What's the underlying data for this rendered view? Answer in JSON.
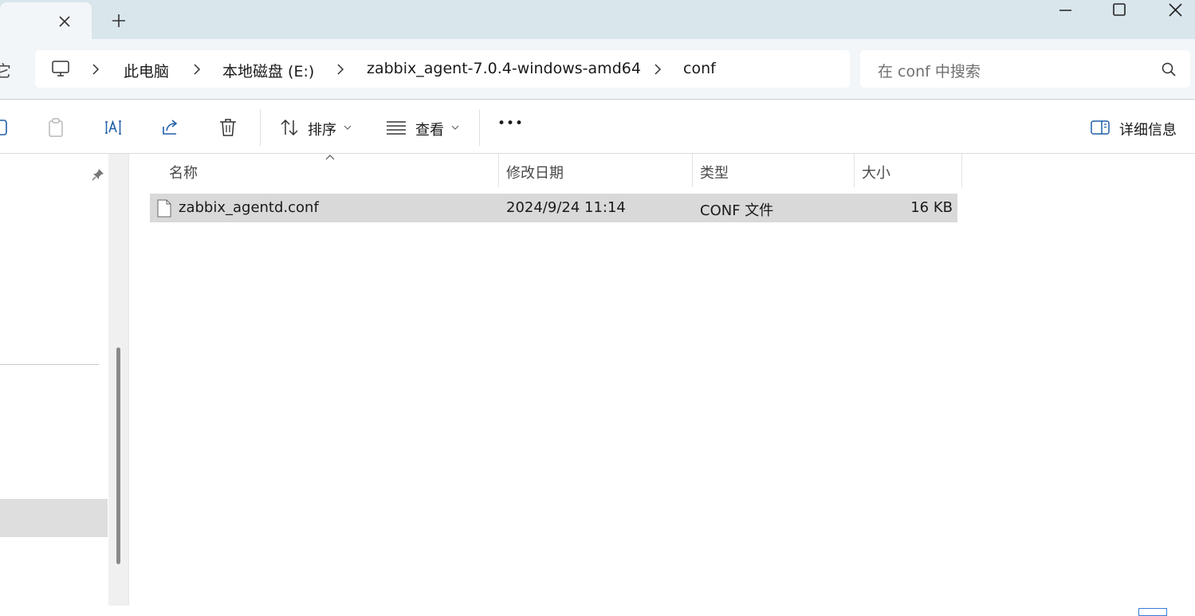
{
  "window": {
    "new_tab_symbol": "+",
    "controls": [
      "minimize-icon",
      "maximize-icon",
      "close-icon"
    ]
  },
  "address": {
    "edge_glyph": "它",
    "breadcrumbs": [
      {
        "label": "此电脑"
      },
      {
        "label": "本地磁盘 (E:)"
      },
      {
        "label": "zabbix_agent-7.0.4-windows-amd64"
      },
      {
        "label": "conf"
      }
    ]
  },
  "search": {
    "placeholder": "在 conf 中搜索"
  },
  "toolbar": {
    "sort_label": "排序",
    "view_label": "查看",
    "more_label": "•••",
    "details_label": "详细信息"
  },
  "columns": {
    "name": "名称",
    "modified": "修改日期",
    "type": "类型",
    "size": "大小"
  },
  "files": [
    {
      "name": "zabbix_agentd.conf",
      "modified": "2024/9/24 11:14",
      "type": "CONF 文件",
      "size": "16 KB",
      "selected": true
    }
  ],
  "colors": {
    "titlebar": "#d9e6ec",
    "address_bar": "#f3f6f8",
    "selection": "#d9d9d9",
    "accent_icon": "#1f5fa8"
  }
}
